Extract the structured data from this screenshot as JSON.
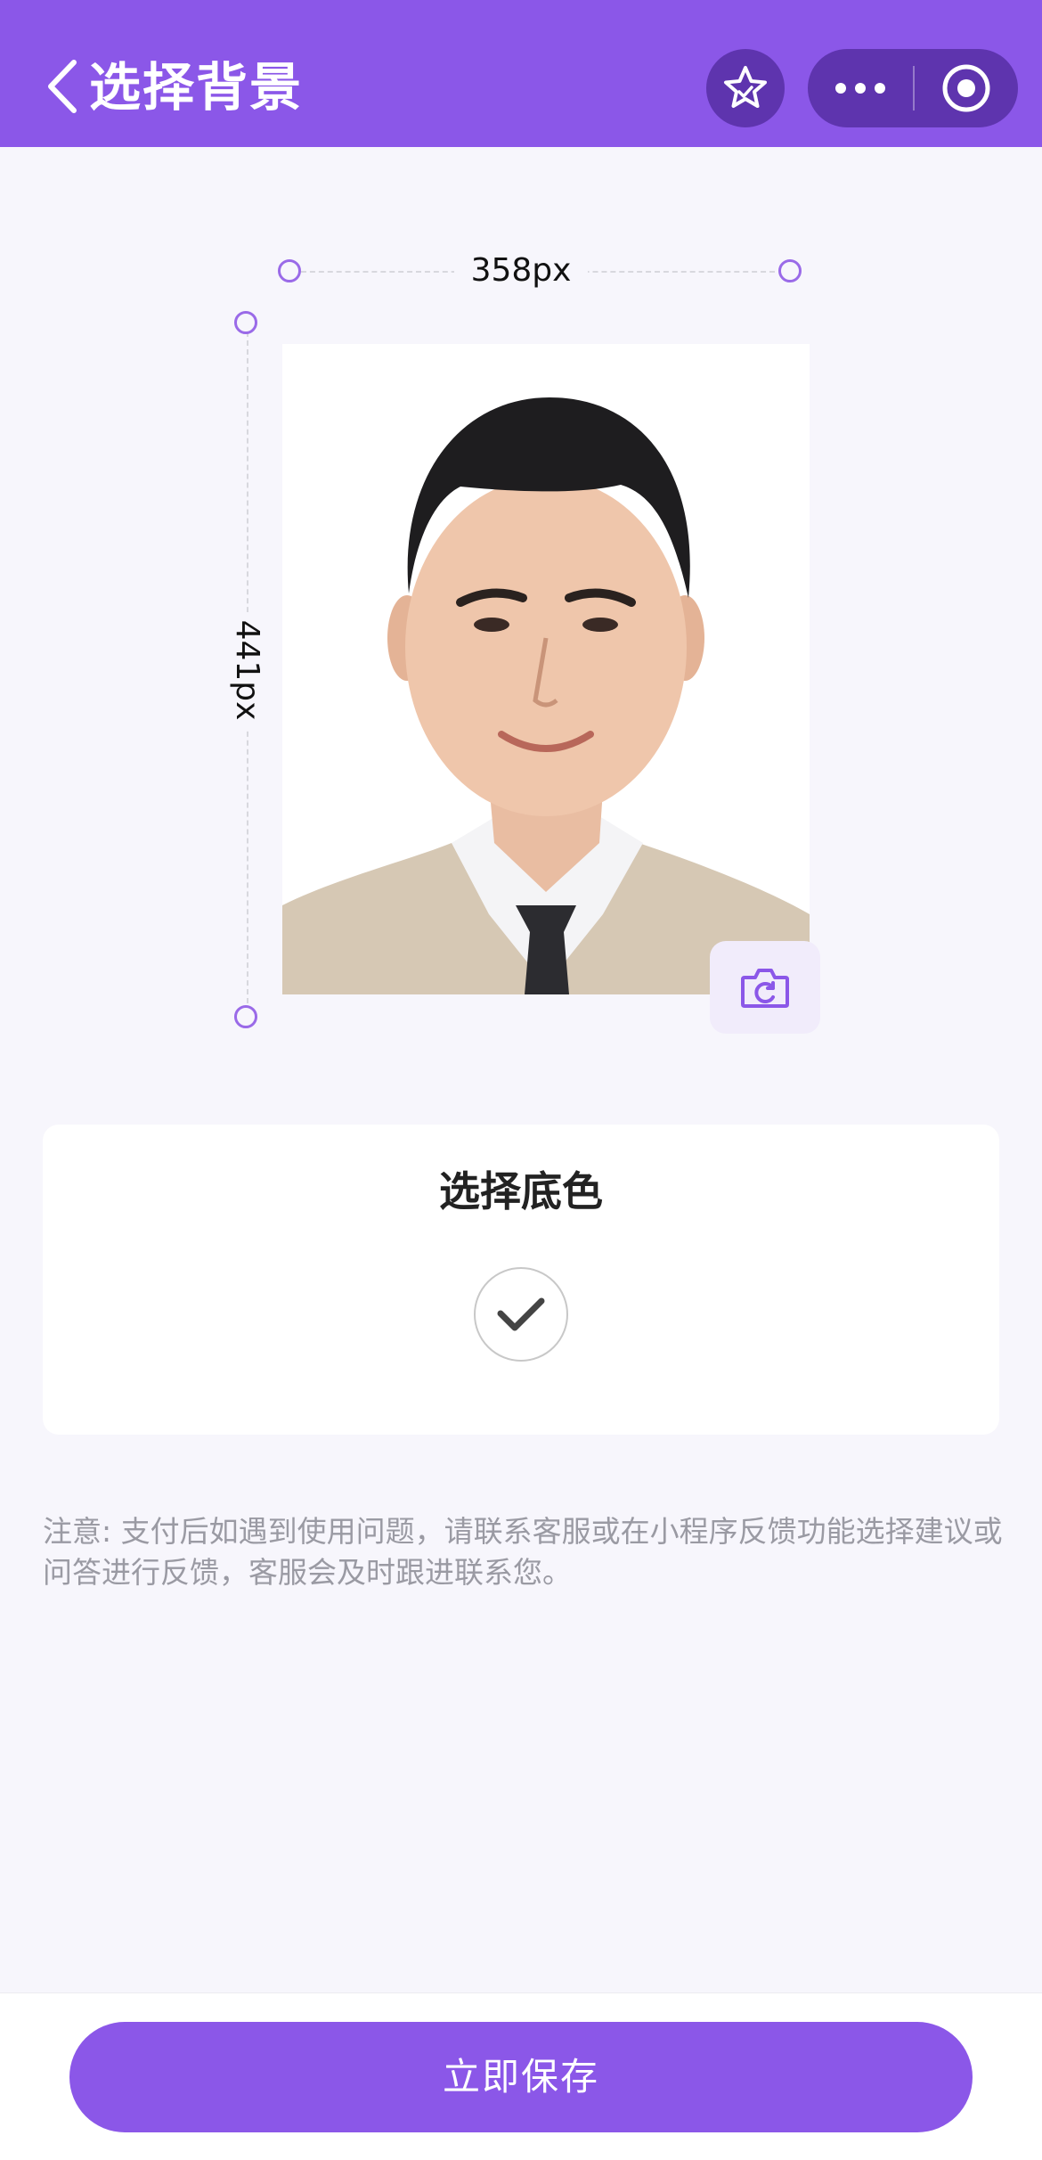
{
  "header": {
    "title": "选择背景",
    "accent_color": "#8b57e8",
    "icons": [
      "back-arrow-icon",
      "star-icon",
      "more-dots-icon",
      "close-circle-icon"
    ]
  },
  "dimensions": {
    "width_label": "358px",
    "height_label": "441px"
  },
  "photo": {
    "description_icon": "portrait-photo",
    "background_color": "#ffffff",
    "camera_icon": "camera-rotate-icon"
  },
  "color_picker": {
    "title": "选择底色",
    "selected_color": "#ffffff",
    "selected_icon": "checkmark-icon"
  },
  "note": "注意: 支付后如遇到使用问题，请联系客服或在小程序反馈功能选择建议或问答进行反馈，客服会及时跟进联系您。",
  "footer": {
    "save_label": "立即保存"
  }
}
